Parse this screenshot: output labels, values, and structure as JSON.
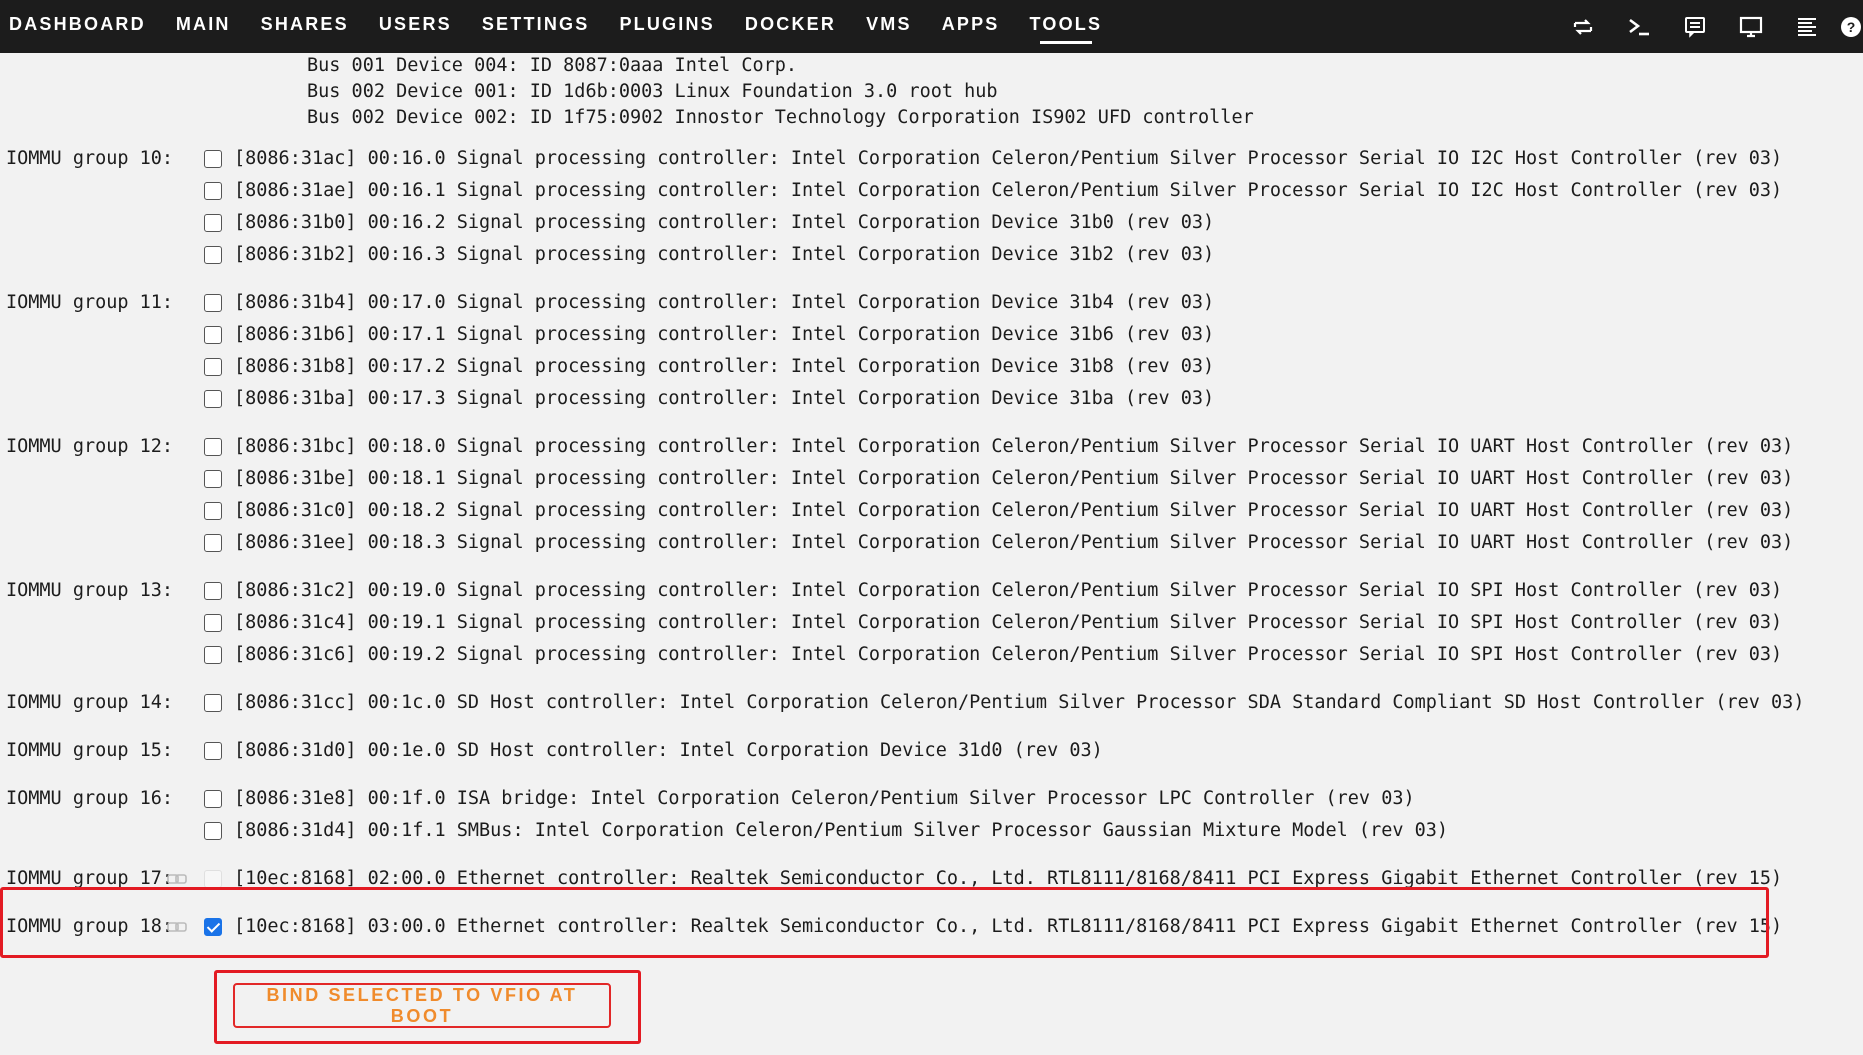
{
  "nav": {
    "tabs": [
      "DASHBOARD",
      "MAIN",
      "SHARES",
      "USERS",
      "SETTINGS",
      "PLUGINS",
      "DOCKER",
      "VMS",
      "APPS",
      "TOOLS"
    ],
    "active_tab": "TOOLS",
    "icons": [
      "refresh-icon",
      "terminal-icon",
      "feedback-icon",
      "monitor-icon",
      "log-icon",
      "help-icon"
    ]
  },
  "usb_devices": [
    "Bus 001 Device 004: ID 8087:0aaa Intel Corp.",
    "Bus 002 Device 001: ID 1d6b:0003 Linux Foundation 3.0 root hub",
    "Bus 002 Device 002: ID 1f75:0902 Innostor Technology Corporation IS902 UFD controller"
  ],
  "iommu_groups": [
    {
      "label": "IOMMU group 10:",
      "devices": [
        {
          "text": "[8086:31ac] 00:16.0 Signal processing controller: Intel Corporation Celeron/Pentium Silver Processor Serial IO I2C Host Controller (rev 03)",
          "checked": false
        },
        {
          "text": "[8086:31ae] 00:16.1 Signal processing controller: Intel Corporation Celeron/Pentium Silver Processor Serial IO I2C Host Controller (rev 03)",
          "checked": false
        },
        {
          "text": "[8086:31b0] 00:16.2 Signal processing controller: Intel Corporation Device 31b0 (rev 03)",
          "checked": false
        },
        {
          "text": "[8086:31b2] 00:16.3 Signal processing controller: Intel Corporation Device 31b2 (rev 03)",
          "checked": false
        }
      ]
    },
    {
      "label": "IOMMU group 11:",
      "devices": [
        {
          "text": "[8086:31b4] 00:17.0 Signal processing controller: Intel Corporation Device 31b4 (rev 03)",
          "checked": false
        },
        {
          "text": "[8086:31b6] 00:17.1 Signal processing controller: Intel Corporation Device 31b6 (rev 03)",
          "checked": false
        },
        {
          "text": "[8086:31b8] 00:17.2 Signal processing controller: Intel Corporation Device 31b8 (rev 03)",
          "checked": false
        },
        {
          "text": "[8086:31ba] 00:17.3 Signal processing controller: Intel Corporation Device 31ba (rev 03)",
          "checked": false
        }
      ]
    },
    {
      "label": "IOMMU group 12:",
      "devices": [
        {
          "text": "[8086:31bc] 00:18.0 Signal processing controller: Intel Corporation Celeron/Pentium Silver Processor Serial IO UART Host Controller (rev 03)",
          "checked": false
        },
        {
          "text": "[8086:31be] 00:18.1 Signal processing controller: Intel Corporation Celeron/Pentium Silver Processor Serial IO UART Host Controller (rev 03)",
          "checked": false
        },
        {
          "text": "[8086:31c0] 00:18.2 Signal processing controller: Intel Corporation Celeron/Pentium Silver Processor Serial IO UART Host Controller (rev 03)",
          "checked": false
        },
        {
          "text": "[8086:31ee] 00:18.3 Signal processing controller: Intel Corporation Celeron/Pentium Silver Processor Serial IO UART Host Controller (rev 03)",
          "checked": false
        }
      ]
    },
    {
      "label": "IOMMU group 13:",
      "devices": [
        {
          "text": "[8086:31c2] 00:19.0 Signal processing controller: Intel Corporation Celeron/Pentium Silver Processor Serial IO SPI Host Controller (rev 03)",
          "checked": false
        },
        {
          "text": "[8086:31c4] 00:19.1 Signal processing controller: Intel Corporation Celeron/Pentium Silver Processor Serial IO SPI Host Controller (rev 03)",
          "checked": false
        },
        {
          "text": "[8086:31c6] 00:19.2 Signal processing controller: Intel Corporation Celeron/Pentium Silver Processor Serial IO SPI Host Controller (rev 03)",
          "checked": false
        }
      ]
    },
    {
      "label": "IOMMU group 14:",
      "devices": [
        {
          "text": "[8086:31cc] 00:1c.0 SD Host controller: Intel Corporation Celeron/Pentium Silver Processor SDA Standard Compliant SD Host Controller (rev 03)",
          "checked": false
        }
      ]
    },
    {
      "label": "IOMMU group 15:",
      "devices": [
        {
          "text": "[8086:31d0] 00:1e.0 SD Host controller: Intel Corporation Device 31d0 (rev 03)",
          "checked": false
        }
      ]
    },
    {
      "label": "IOMMU group 16:",
      "devices": [
        {
          "text": "[8086:31e8] 00:1f.0 ISA bridge: Intel Corporation Celeron/Pentium Silver Processor LPC Controller (rev 03)",
          "checked": false
        },
        {
          "text": "[8086:31d4] 00:1f.1 SMBus: Intel Corporation Celeron/Pentium Silver Processor Gaussian Mixture Model (rev 03)",
          "checked": false
        }
      ]
    },
    {
      "label": "IOMMU group 17:",
      "has_link_icon": true,
      "devices": [
        {
          "text": "[10ec:8168] 02:00.0 Ethernet controller: Realtek Semiconductor Co., Ltd. RTL8111/8168/8411 PCI Express Gigabit Ethernet Controller (rev 15)",
          "checked": false,
          "disabled": true
        }
      ]
    },
    {
      "label": "IOMMU group 18:",
      "has_link_icon": true,
      "highlighted": true,
      "devices": [
        {
          "text": "[10ec:8168] 03:00.0 Ethernet controller: Realtek Semiconductor Co., Ltd. RTL8111/8168/8411 PCI Express Gigabit Ethernet Controller (rev 15)",
          "checked": true
        }
      ]
    }
  ],
  "bind_button": {
    "label": "BIND SELECTED TO VFIO AT BOOT"
  },
  "colors": {
    "nav_bg": "#1c1c1c",
    "page_bg": "#f2f2f2",
    "accent_orange": "#f08b2c",
    "highlight_red": "#e31b23",
    "checkbox_blue": "#1a73e8"
  }
}
